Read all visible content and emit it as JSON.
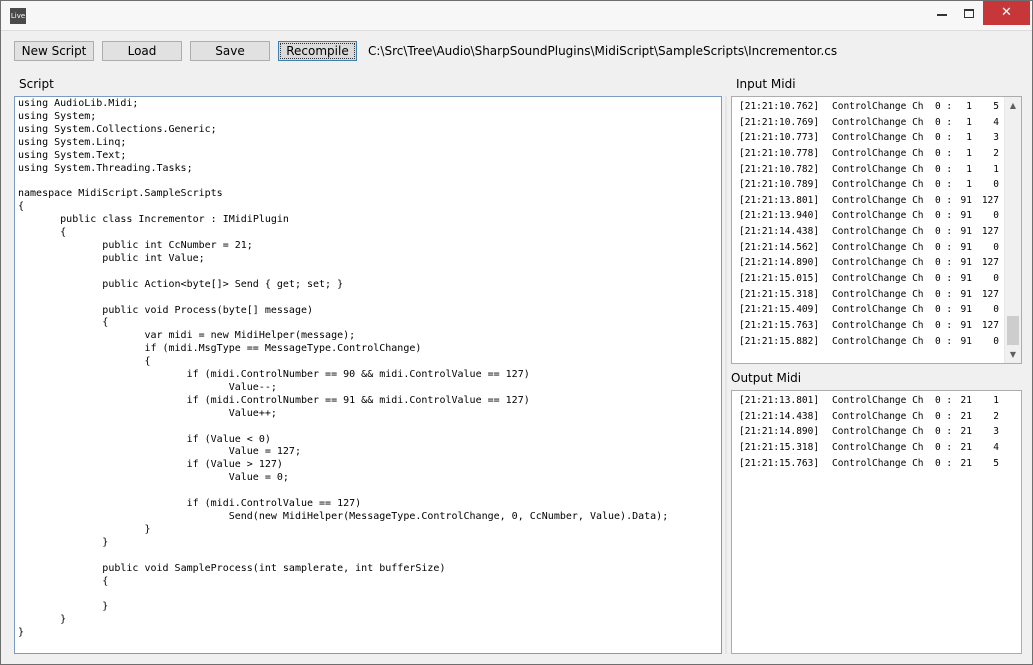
{
  "window": {
    "icon_label": "Live",
    "minimize_glyph": "",
    "maximize_glyph": "",
    "close_glyph": "✕"
  },
  "toolbar": {
    "new_script_label": "New Script",
    "load_label": "Load",
    "save_label": "Save",
    "recompile_label": "Recompile",
    "file_path": "C:\\Src\\Tree\\Audio\\SharpSoundPlugins\\MidiScript\\SampleScripts\\Incrementor.cs"
  },
  "labels": {
    "script": "Script",
    "input_midi": "Input Midi",
    "output_midi": "Output Midi"
  },
  "editor": {
    "code": "using AudioLib.Midi;\nusing System;\nusing System.Collections.Generic;\nusing System.Linq;\nusing System.Text;\nusing System.Threading.Tasks;\n\nnamespace MidiScript.SampleScripts\n{\n\tpublic class Incrementor : IMidiPlugin\n\t{\n\t\tpublic int CcNumber = 21;\n\t\tpublic int Value;\n\n\t\tpublic Action<byte[]> Send { get; set; }\n\n\t\tpublic void Process(byte[] message)\n\t\t{\n\t\t\tvar midi = new MidiHelper(message);\n\t\t\tif (midi.MsgType == MessageType.ControlChange)\n\t\t\t{\n\t\t\t\tif (midi.ControlNumber == 90 && midi.ControlValue == 127)\n\t\t\t\t\tValue--;\n\t\t\t\tif (midi.ControlNumber == 91 && midi.ControlValue == 127)\n\t\t\t\t\tValue++;\n\n\t\t\t\tif (Value < 0)\n\t\t\t\t\tValue = 127;\n\t\t\t\tif (Value > 127)\n\t\t\t\t\tValue = 0;\n\n\t\t\t\tif (midi.ControlValue == 127)\n\t\t\t\t\tSend(new MidiHelper(MessageType.ControlChange, 0, CcNumber, Value).Data);\n\t\t\t}\n\t\t}\n\n\t\tpublic void SampleProcess(int samplerate, int bufferSize)\n\t\t{\n\n\t\t}\n\t}\n}"
  },
  "input_midi": {
    "rows": [
      {
        "ts": "[21:21:10.762]",
        "type": "ControlChange Ch  0 :",
        "v1": "1",
        "v2": "5"
      },
      {
        "ts": "[21:21:10.769]",
        "type": "ControlChange Ch  0 :",
        "v1": "1",
        "v2": "4"
      },
      {
        "ts": "[21:21:10.773]",
        "type": "ControlChange Ch  0 :",
        "v1": "1",
        "v2": "3"
      },
      {
        "ts": "[21:21:10.778]",
        "type": "ControlChange Ch  0 :",
        "v1": "1",
        "v2": "2"
      },
      {
        "ts": "[21:21:10.782]",
        "type": "ControlChange Ch  0 :",
        "v1": "1",
        "v2": "1"
      },
      {
        "ts": "[21:21:10.789]",
        "type": "ControlChange Ch  0 :",
        "v1": "1",
        "v2": "0"
      },
      {
        "ts": "[21:21:13.801]",
        "type": "ControlChange Ch  0 :",
        "v1": "91",
        "v2": "127"
      },
      {
        "ts": "[21:21:13.940]",
        "type": "ControlChange Ch  0 :",
        "v1": "91",
        "v2": "0"
      },
      {
        "ts": "[21:21:14.438]",
        "type": "ControlChange Ch  0 :",
        "v1": "91",
        "v2": "127"
      },
      {
        "ts": "[21:21:14.562]",
        "type": "ControlChange Ch  0 :",
        "v1": "91",
        "v2": "0"
      },
      {
        "ts": "[21:21:14.890]",
        "type": "ControlChange Ch  0 :",
        "v1": "91",
        "v2": "127"
      },
      {
        "ts": "[21:21:15.015]",
        "type": "ControlChange Ch  0 :",
        "v1": "91",
        "v2": "0"
      },
      {
        "ts": "[21:21:15.318]",
        "type": "ControlChange Ch  0 :",
        "v1": "91",
        "v2": "127"
      },
      {
        "ts": "[21:21:15.409]",
        "type": "ControlChange Ch  0 :",
        "v1": "91",
        "v2": "0"
      },
      {
        "ts": "[21:21:15.763]",
        "type": "ControlChange Ch  0 :",
        "v1": "91",
        "v2": "127"
      },
      {
        "ts": "[21:21:15.882]",
        "type": "ControlChange Ch  0 :",
        "v1": "91",
        "v2": "0"
      }
    ]
  },
  "output_midi": {
    "rows": [
      {
        "ts": "[21:21:13.801]",
        "type": "ControlChange Ch  0 :",
        "v1": "21",
        "v2": "1"
      },
      {
        "ts": "[21:21:14.438]",
        "type": "ControlChange Ch  0 :",
        "v1": "21",
        "v2": "2"
      },
      {
        "ts": "[21:21:14.890]",
        "type": "ControlChange Ch  0 :",
        "v1": "21",
        "v2": "3"
      },
      {
        "ts": "[21:21:15.318]",
        "type": "ControlChange Ch  0 :",
        "v1": "21",
        "v2": "4"
      },
      {
        "ts": "[21:21:15.763]",
        "type": "ControlChange Ch  0 :",
        "v1": "21",
        "v2": "5"
      }
    ]
  },
  "scrollbar": {
    "up_icon": "chevron-up-icon",
    "down_icon": "chevron-down-icon",
    "up_glyph": "▲",
    "down_glyph": "▼"
  },
  "colors": {
    "close_button": "#c7373a",
    "editor_border": "#7a9cc4",
    "focused_button_border": "#3c7fb1"
  }
}
